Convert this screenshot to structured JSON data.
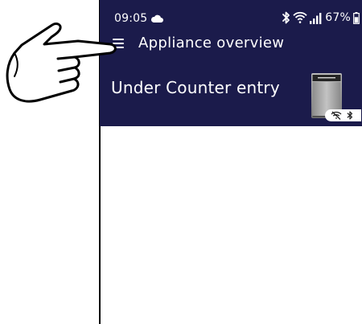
{
  "status_bar": {
    "time": "09:05",
    "battery": "67%",
    "icons": [
      "cloud-icon",
      "bluetooth-icon",
      "wifi-icon",
      "signal-icon",
      "battery-icon"
    ]
  },
  "top_bar": {
    "title": "Appliance overview",
    "menu_icon": "menu-icon"
  },
  "appliance": {
    "name": "Under Counter entry",
    "image_icon": "dishwasher-icon",
    "status_icons": [
      "wifi-off-icon",
      "bluetooth-icon"
    ]
  },
  "colors": {
    "header_bg": "#1b1b4b",
    "text_on_header": "#ffffff",
    "background": "#ffffff"
  }
}
